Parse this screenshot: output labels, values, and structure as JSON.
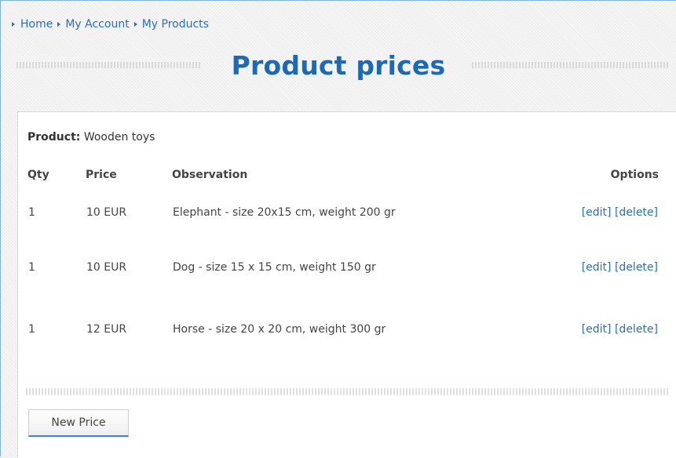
{
  "breadcrumb": [
    {
      "label": "Home"
    },
    {
      "label": "My Account"
    },
    {
      "label": "My Products"
    }
  ],
  "page_title": "Product prices",
  "product": {
    "label": "Product:",
    "value": "Wooden toys"
  },
  "table": {
    "headers": {
      "qty": "Qty",
      "price": "Price",
      "observation": "Observation",
      "options": "Options"
    },
    "rows": [
      {
        "qty": "1",
        "price": "10 EUR",
        "observation": "Elephant - size 20x15 cm, weight 200 gr",
        "edit": "[edit]",
        "delete": "[delete]"
      },
      {
        "qty": "1",
        "price": "10 EUR",
        "observation": "Dog - size 15 x 15 cm, weight 150 gr",
        "edit": "[edit]",
        "delete": "[delete]"
      },
      {
        "qty": "1",
        "price": "12 EUR",
        "observation": "Horse - size 20 x 20 cm, weight 300 gr",
        "edit": "[edit]",
        "delete": "[delete]"
      }
    ]
  },
  "new_price_button": "New Price",
  "colors": {
    "accent": "#1d6ab3",
    "link": "#2a6fb7",
    "button_underline": "#3c86cf"
  }
}
